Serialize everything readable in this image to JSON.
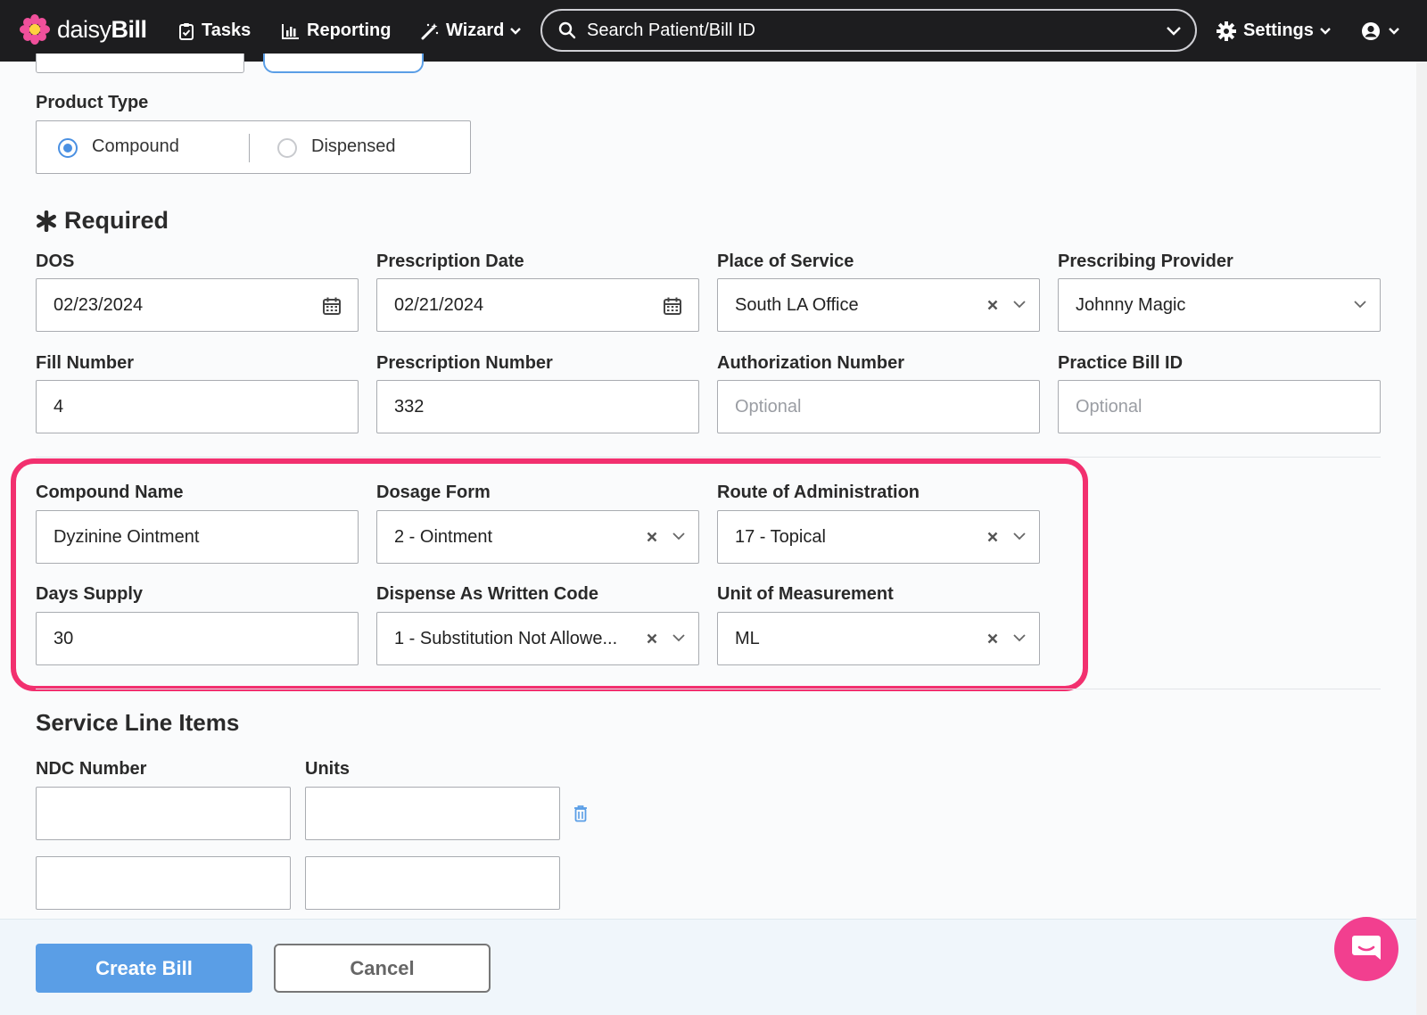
{
  "nav": {
    "brand_light": "daisy",
    "brand_bold": "Bill",
    "tasks": "Tasks",
    "reporting": "Reporting",
    "wizard": "Wizard",
    "search_placeholder": "Search Patient/Bill ID",
    "settings": "Settings"
  },
  "product_type": {
    "label": "Product Type",
    "options": [
      "Compound",
      "Dispensed"
    ],
    "selected": "Compound"
  },
  "required_title": "Required",
  "fields": {
    "dos": {
      "label": "DOS",
      "value": "02/23/2024"
    },
    "prescription_date": {
      "label": "Prescription Date",
      "value": "02/21/2024"
    },
    "place_of_service": {
      "label": "Place of Service",
      "value": "South LA Office"
    },
    "prescribing_provider": {
      "label": "Prescribing Provider",
      "value": "Johnny Magic"
    },
    "fill_number": {
      "label": "Fill Number",
      "value": "4"
    },
    "prescription_number": {
      "label": "Prescription Number",
      "value": "332"
    },
    "authorization_number": {
      "label": "Authorization Number",
      "placeholder": "Optional"
    },
    "practice_bill_id": {
      "label": "Practice Bill ID",
      "placeholder": "Optional"
    },
    "compound_name": {
      "label": "Compound Name",
      "value": "Dyzinine Ointment"
    },
    "dosage_form": {
      "label": "Dosage Form",
      "value": "2 - Ointment"
    },
    "route_of_administration": {
      "label": "Route of Administration",
      "value": "17 - Topical"
    },
    "days_supply": {
      "label": "Days Supply",
      "value": "30"
    },
    "daw_code": {
      "label": "Dispense As Written Code",
      "value": "1 - Substitution Not Allowe..."
    },
    "unit_of_measurement": {
      "label": "Unit of Measurement",
      "value": "ML"
    }
  },
  "service_lines": {
    "title": "Service Line Items",
    "ndc_label": "NDC Number",
    "units_label": "Units"
  },
  "actions": {
    "create": "Create Bill",
    "cancel": "Cancel"
  },
  "colors": {
    "accent": "#5a9ee6",
    "highlight": "#f2306f",
    "nav_bg": "#1d1d1f"
  }
}
